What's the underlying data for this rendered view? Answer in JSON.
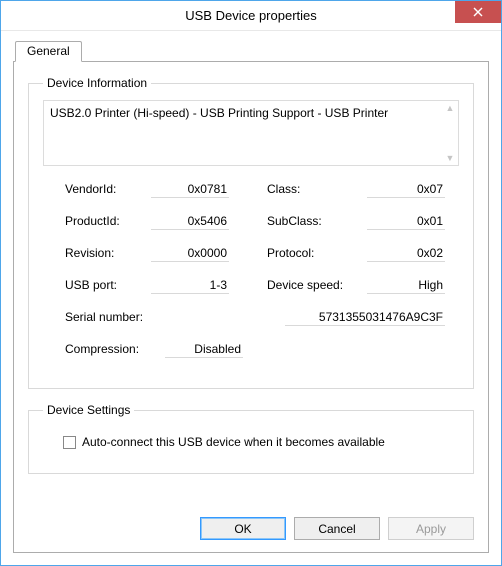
{
  "window": {
    "title": "USB Device properties",
    "close_icon": "close"
  },
  "tabs": {
    "general": "General"
  },
  "device_info": {
    "legend": "Device Information",
    "description": "USB2.0 Printer (Hi-speed) - USB Printing Support - USB Printer",
    "fields": {
      "vendorid_label": "VendorId:",
      "vendorid_value": "0x0781",
      "class_label": "Class:",
      "class_value": "0x07",
      "productid_label": "ProductId:",
      "productid_value": "0x5406",
      "subclass_label": "SubClass:",
      "subclass_value": "0x01",
      "revision_label": "Revision:",
      "revision_value": "0x0000",
      "protocol_label": "Protocol:",
      "protocol_value": "0x02",
      "usbport_label": "USB port:",
      "usbport_value": "1-3",
      "devspeed_label": "Device speed:",
      "devspeed_value": "High",
      "serial_label": "Serial number:",
      "serial_value": "5731355031476A9C3F",
      "compression_label": "Compression:",
      "compression_value": "Disabled"
    }
  },
  "device_settings": {
    "legend": "Device Settings",
    "autoconnect_label": "Auto-connect this USB device when it becomes available",
    "autoconnect_checked": false
  },
  "buttons": {
    "ok": "OK",
    "cancel": "Cancel",
    "apply": "Apply"
  }
}
